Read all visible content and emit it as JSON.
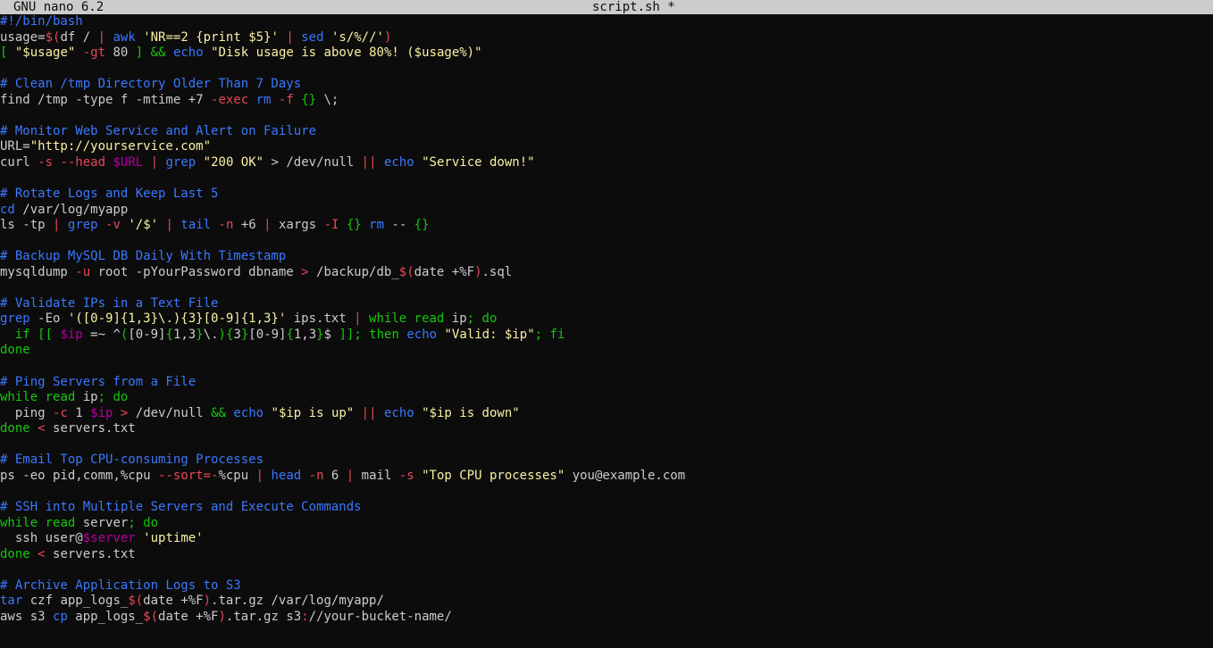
{
  "titlebar": {
    "app_name": "GNU nano 6.2",
    "file_name": "script.sh *"
  },
  "colors": {
    "background": "#0c0c0c",
    "text": "#cccccc",
    "comment": "#3b78ff",
    "keyword": "#16c60c",
    "string": "#f9f1a5",
    "flag": "#e74856",
    "variable": "#b4009e",
    "titlebar_bg": "#cccccc"
  },
  "lines": [
    [
      [
        "c",
        "#!/bin/bash"
      ]
    ],
    [
      [
        "t",
        "usage="
      ],
      [
        "r",
        "$("
      ],
      [
        "t",
        "df / "
      ],
      [
        "r",
        "|"
      ],
      [
        "t",
        " "
      ],
      [
        "b",
        "awk"
      ],
      [
        "t",
        " "
      ],
      [
        "y",
        "'NR==2 {print $5}'"
      ],
      [
        "t",
        " "
      ],
      [
        "r",
        "|"
      ],
      [
        "t",
        " "
      ],
      [
        "b",
        "sed"
      ],
      [
        "t",
        " "
      ],
      [
        "y",
        "'s/%//'"
      ],
      [
        "r",
        ")"
      ]
    ],
    [
      [
        "g",
        "["
      ],
      [
        "t",
        " "
      ],
      [
        "y",
        "\"$usage\""
      ],
      [
        "t",
        " "
      ],
      [
        "r",
        "-gt"
      ],
      [
        "t",
        " 80 "
      ],
      [
        "g",
        "]"
      ],
      [
        "t",
        " "
      ],
      [
        "g",
        "&&"
      ],
      [
        "t",
        " "
      ],
      [
        "b",
        "echo"
      ],
      [
        "t",
        " "
      ],
      [
        "y",
        "\"Disk usage is above 80%! ($usage%)\""
      ]
    ],
    [],
    [
      [
        "c",
        "# Clean /tmp Directory Older Than 7 Days"
      ]
    ],
    [
      [
        "t",
        "find /tmp -type f -mtime +7 "
      ],
      [
        "r",
        "-exec"
      ],
      [
        "t",
        " "
      ],
      [
        "b",
        "rm"
      ],
      [
        "t",
        " "
      ],
      [
        "r",
        "-f"
      ],
      [
        "t",
        " "
      ],
      [
        "g",
        "{}"
      ],
      [
        "t",
        " \\;"
      ]
    ],
    [],
    [
      [
        "c",
        "# Monitor Web Service and Alert on Failure"
      ]
    ],
    [
      [
        "t",
        "URL="
      ],
      [
        "y",
        "\"http://yourservice.com\""
      ]
    ],
    [
      [
        "t",
        "curl "
      ],
      [
        "r",
        "-s"
      ],
      [
        "t",
        " "
      ],
      [
        "r",
        "--head"
      ],
      [
        "t",
        " "
      ],
      [
        "m",
        "$URL"
      ],
      [
        "t",
        " "
      ],
      [
        "r",
        "|"
      ],
      [
        "t",
        " "
      ],
      [
        "b",
        "grep"
      ],
      [
        "t",
        " "
      ],
      [
        "y",
        "\"200 OK\""
      ],
      [
        "t",
        " > /dev/null "
      ],
      [
        "r",
        "||"
      ],
      [
        "t",
        " "
      ],
      [
        "b",
        "echo"
      ],
      [
        "t",
        " "
      ],
      [
        "y",
        "\"Service down!\""
      ]
    ],
    [],
    [
      [
        "c",
        "# Rotate Logs and Keep Last 5"
      ]
    ],
    [
      [
        "b",
        "cd"
      ],
      [
        "t",
        " /var/log/myapp"
      ]
    ],
    [
      [
        "t",
        "ls -tp "
      ],
      [
        "r",
        "|"
      ],
      [
        "t",
        " "
      ],
      [
        "b",
        "grep"
      ],
      [
        "t",
        " "
      ],
      [
        "r",
        "-v"
      ],
      [
        "t",
        " "
      ],
      [
        "y",
        "'/$'"
      ],
      [
        "t",
        " "
      ],
      [
        "r",
        "|"
      ],
      [
        "t",
        " "
      ],
      [
        "b",
        "tail"
      ],
      [
        "t",
        " "
      ],
      [
        "r",
        "-n"
      ],
      [
        "t",
        " +6 "
      ],
      [
        "r",
        "|"
      ],
      [
        "t",
        " xargs "
      ],
      [
        "r",
        "-I"
      ],
      [
        "t",
        " "
      ],
      [
        "g",
        "{}"
      ],
      [
        "t",
        " "
      ],
      [
        "b",
        "rm"
      ],
      [
        "t",
        " -- "
      ],
      [
        "g",
        "{}"
      ]
    ],
    [],
    [
      [
        "c",
        "# Backup MySQL DB Daily With Timestamp"
      ]
    ],
    [
      [
        "t",
        "mysqldump "
      ],
      [
        "r",
        "-u"
      ],
      [
        "t",
        " root -pYourPassword dbname "
      ],
      [
        "r",
        ">"
      ],
      [
        "t",
        " /backup/db_"
      ],
      [
        "r",
        "$("
      ],
      [
        "t",
        "date +%F"
      ],
      [
        "r",
        ")"
      ],
      [
        "t",
        ".sql"
      ]
    ],
    [],
    [
      [
        "c",
        "# Validate IPs in a Text File"
      ]
    ],
    [
      [
        "b",
        "grep"
      ],
      [
        "t",
        " -Eo "
      ],
      [
        "y",
        "'([0-9]{1,3}\\.){3}[0-9]{1,3}'"
      ],
      [
        "t",
        " ips.txt "
      ],
      [
        "r",
        "|"
      ],
      [
        "t",
        " "
      ],
      [
        "g",
        "while"
      ],
      [
        "t",
        " "
      ],
      [
        "g",
        "read"
      ],
      [
        "t",
        " ip"
      ],
      [
        "g",
        "; do"
      ]
    ],
    [
      [
        "t",
        "  "
      ],
      [
        "g",
        "if"
      ],
      [
        "t",
        " "
      ],
      [
        "g",
        "[["
      ],
      [
        "t",
        " "
      ],
      [
        "m",
        "$ip"
      ],
      [
        "t",
        " =~ ^"
      ],
      [
        "g",
        "("
      ],
      [
        "t",
        "[0-9]"
      ],
      [
        "g",
        "{"
      ],
      [
        "t",
        "1,3"
      ],
      [
        "g",
        "}"
      ],
      [
        "t",
        "\\."
      ],
      [
        "g",
        ")"
      ],
      [
        "g",
        "{"
      ],
      [
        "t",
        "3"
      ],
      [
        "g",
        "}"
      ],
      [
        "t",
        "[0-9]"
      ],
      [
        "g",
        "{"
      ],
      [
        "t",
        "1,3"
      ],
      [
        "g",
        "}"
      ],
      [
        "t",
        "$ "
      ],
      [
        "g",
        "]]"
      ],
      [
        "g",
        "; then"
      ],
      [
        "t",
        " "
      ],
      [
        "b",
        "echo"
      ],
      [
        "t",
        " "
      ],
      [
        "y",
        "\"Valid: $ip\""
      ],
      [
        "g",
        "; fi"
      ]
    ],
    [
      [
        "g",
        "done"
      ]
    ],
    [],
    [
      [
        "c",
        "# Ping Servers from a File"
      ]
    ],
    [
      [
        "g",
        "while"
      ],
      [
        "t",
        " "
      ],
      [
        "g",
        "read"
      ],
      [
        "t",
        " ip"
      ],
      [
        "g",
        "; do"
      ]
    ],
    [
      [
        "t",
        "  ping "
      ],
      [
        "r",
        "-c"
      ],
      [
        "t",
        " 1 "
      ],
      [
        "m",
        "$ip"
      ],
      [
        "t",
        " "
      ],
      [
        "r",
        ">"
      ],
      [
        "t",
        " /dev/null "
      ],
      [
        "g",
        "&&"
      ],
      [
        "t",
        " "
      ],
      [
        "b",
        "echo"
      ],
      [
        "t",
        " "
      ],
      [
        "y",
        "\"$ip is up\""
      ],
      [
        "t",
        " "
      ],
      [
        "r",
        "||"
      ],
      [
        "t",
        " "
      ],
      [
        "b",
        "echo"
      ],
      [
        "t",
        " "
      ],
      [
        "y",
        "\"$ip is down\""
      ]
    ],
    [
      [
        "g",
        "done"
      ],
      [
        "t",
        " "
      ],
      [
        "r",
        "<"
      ],
      [
        "t",
        " servers.txt"
      ]
    ],
    [],
    [
      [
        "c",
        "# Email Top CPU-consuming Processes"
      ]
    ],
    [
      [
        "t",
        "ps -eo pid,comm,%cpu "
      ],
      [
        "r",
        "--sort=-"
      ],
      [
        "t",
        "%cpu "
      ],
      [
        "r",
        "|"
      ],
      [
        "t",
        " "
      ],
      [
        "b",
        "head"
      ],
      [
        "t",
        " "
      ],
      [
        "r",
        "-n"
      ],
      [
        "t",
        " 6 "
      ],
      [
        "r",
        "|"
      ],
      [
        "t",
        " mail "
      ],
      [
        "r",
        "-s"
      ],
      [
        "t",
        " "
      ],
      [
        "y",
        "\"Top CPU processes\""
      ],
      [
        "t",
        " you@example.com"
      ]
    ],
    [],
    [
      [
        "c",
        "# SSH into Multiple Servers and Execute Commands"
      ]
    ],
    [
      [
        "g",
        "while"
      ],
      [
        "t",
        " "
      ],
      [
        "g",
        "read"
      ],
      [
        "t",
        " server"
      ],
      [
        "g",
        "; do"
      ]
    ],
    [
      [
        "t",
        "  ssh user@"
      ],
      [
        "m",
        "$server"
      ],
      [
        "t",
        " "
      ],
      [
        "y",
        "'uptime'"
      ]
    ],
    [
      [
        "g",
        "done"
      ],
      [
        "t",
        " "
      ],
      [
        "r",
        "<"
      ],
      [
        "t",
        " servers.txt"
      ]
    ],
    [],
    [
      [
        "c",
        "# Archive Application Logs to S3"
      ]
    ],
    [
      [
        "b",
        "tar"
      ],
      [
        "t",
        " czf app_logs_"
      ],
      [
        "r",
        "$("
      ],
      [
        "t",
        "date +%F"
      ],
      [
        "r",
        ")"
      ],
      [
        "t",
        ".tar.gz /var/log/myapp/"
      ]
    ],
    [
      [
        "t",
        "aws s3 "
      ],
      [
        "b",
        "cp"
      ],
      [
        "t",
        " app_logs_"
      ],
      [
        "r",
        "$("
      ],
      [
        "t",
        "date +%F"
      ],
      [
        "r",
        ")"
      ],
      [
        "t",
        ".tar.gz s3"
      ],
      [
        "r",
        ":"
      ],
      [
        "t",
        "//your-bucket-name/"
      ]
    ]
  ]
}
